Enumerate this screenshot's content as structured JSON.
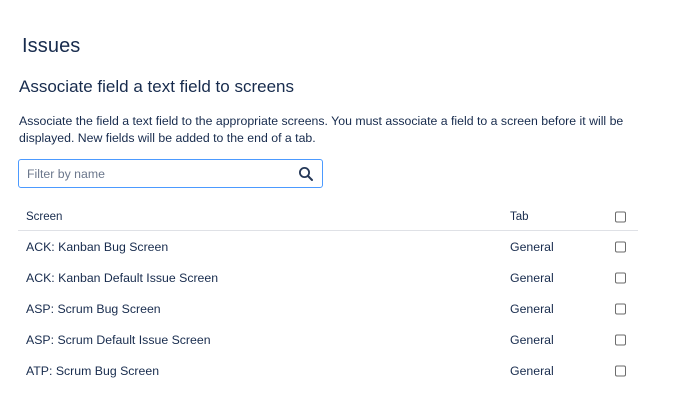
{
  "page": {
    "title": "Issues",
    "section_title": "Associate field a text field to screens",
    "description": "Associate the field a text field to the appropriate screens. You must associate a field to a screen before it will be displayed. New fields will be added to the end of a tab."
  },
  "search": {
    "placeholder": "Filter by name",
    "value": "",
    "icon": "search-icon"
  },
  "table": {
    "headers": {
      "screen": "Screen",
      "tab": "Tab"
    },
    "rows": [
      {
        "screen": "ACK: Kanban Bug Screen",
        "tab": "General",
        "checked": false
      },
      {
        "screen": "ACK: Kanban Default Issue Screen",
        "tab": "General",
        "checked": false
      },
      {
        "screen": "ASP: Scrum Bug Screen",
        "tab": "General",
        "checked": false
      },
      {
        "screen": "ASP: Scrum Default Issue Screen",
        "tab": "General",
        "checked": false
      },
      {
        "screen": "ATP: Scrum Bug Screen",
        "tab": "General",
        "checked": false
      }
    ]
  },
  "colors": {
    "text": "#172b4d",
    "input_border": "#4c9aff",
    "divider": "#dfe1e6",
    "placeholder": "#6b778c"
  }
}
